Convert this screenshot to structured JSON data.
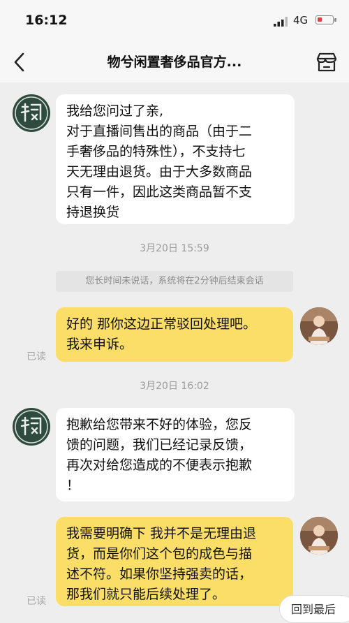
{
  "status_bar": {
    "time": "16:12",
    "network": "4G"
  },
  "header": {
    "title": "物兮闲置奢侈品官方..."
  },
  "messages": [
    {
      "text_lines": [
        "我给您问过了亲,",
        "对于直播间售出的商品（由于二",
        "手奢侈品的特殊性），不支持七",
        "天无理由退货。由于大多数商品",
        "只有一件，因此这类商品暂不支",
        "持退换货"
      ]
    },
    {
      "time": "3月20日 15:59"
    },
    {
      "notice": "您长时间未说话，系统将在2分钟后结束会话"
    },
    {
      "text_lines": [
        "好的 那你这边正常驳回处理吧。",
        "我来申诉。"
      ],
      "read": "已读"
    },
    {
      "time": "3月20日 16:02"
    },
    {
      "text_lines": [
        "抱歉给您带来不好的体验，您反",
        "馈的问题，我们已经记录反馈，",
        "再次对给您造成的不便表示抱歉",
        "！"
      ]
    },
    {
      "text_lines": [
        "我需要明确下 我并不是无理由退",
        "货，而是你们这个包的成色与描",
        "述不符。如果你坚持强卖的话，",
        "那我们就只能后续处理了。"
      ],
      "read": "已读"
    }
  ],
  "floating_button": {
    "label": "回到最后"
  },
  "colors": {
    "user_bubble": "#fbde68",
    "shop_bubble": "#ffffff",
    "background": "#eeeeee"
  },
  "icons": [
    "back-chevron-icon",
    "store-icon",
    "signal-icon",
    "battery-icon"
  ]
}
